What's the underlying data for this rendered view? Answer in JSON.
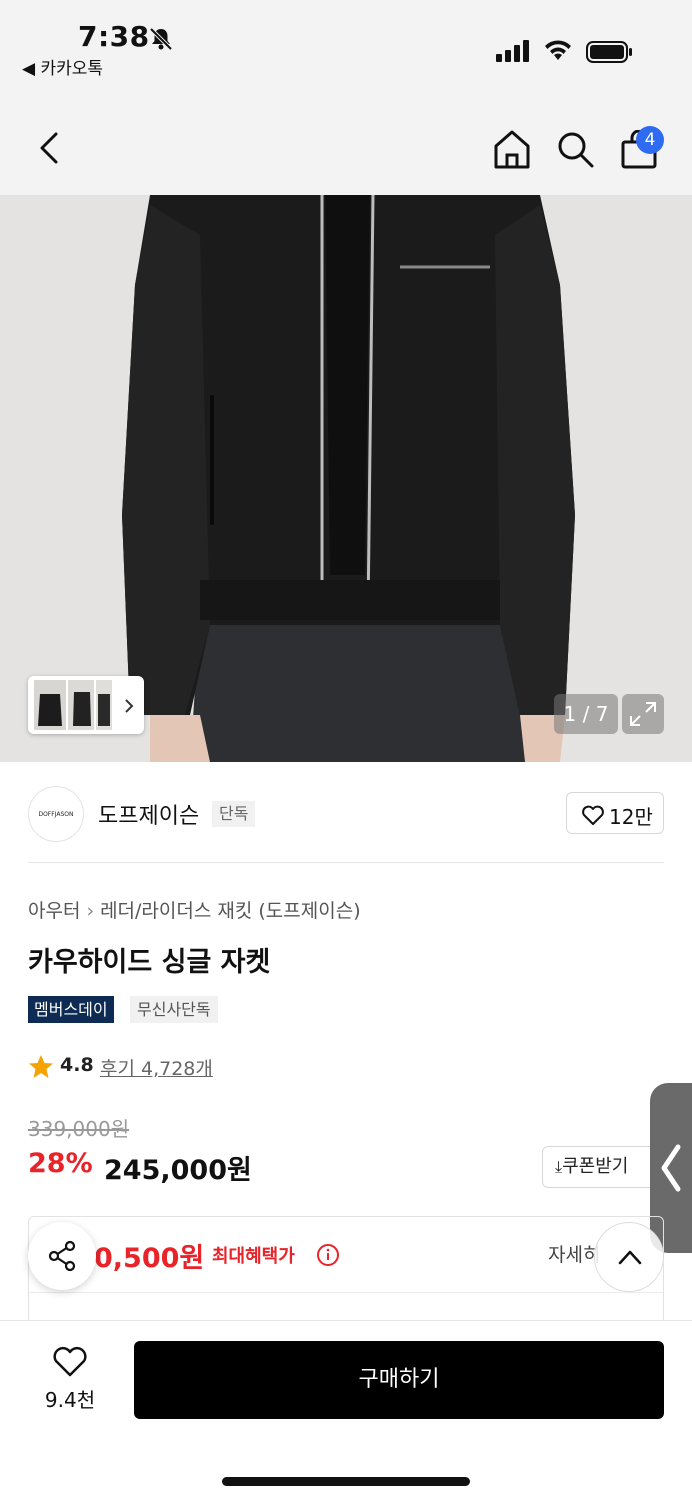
{
  "status_bar": {
    "time": "7:38",
    "back_app": "◀ 카카오톡",
    "icons": [
      "bell-slash-icon",
      "signal-icon",
      "wifi-icon",
      "battery-icon"
    ]
  },
  "header": {
    "icons": [
      "back-icon",
      "home-icon",
      "search-icon",
      "cart-icon"
    ],
    "cart_count": "4"
  },
  "gallery": {
    "counter": "1 / 7",
    "icons": [
      "expand-icon",
      "chevron-right-icon"
    ]
  },
  "brand": {
    "logo_text": "DOFFJASON",
    "name": "도프제이슨",
    "tag": "단독",
    "like_count": "12만"
  },
  "product": {
    "breadcrumb": [
      "아우터",
      "레더/라이더스 재킷 (도프제이슨)"
    ],
    "title": "카우하이드 싱글 자켓",
    "tags": [
      "멤버스데이",
      "무신사단독"
    ],
    "rating": "4.8",
    "reviews": "후기 4,728개",
    "original_price": "339,000원",
    "discount": "28%",
    "sale_price": "245,000원",
    "coupon_label": "쿠폰받기"
  },
  "benefit": {
    "price_partial": "0,500원",
    "label": "최대혜택가",
    "detail_partial": "자세히"
  },
  "bottom": {
    "wish_count": "9.4천",
    "buy_label": "구매하기"
  },
  "colors": {
    "accent_red": "#e8242a",
    "badge_blue": "#2f6bf0",
    "member_navy": "#0e2b54",
    "buy_black": "#000000"
  }
}
